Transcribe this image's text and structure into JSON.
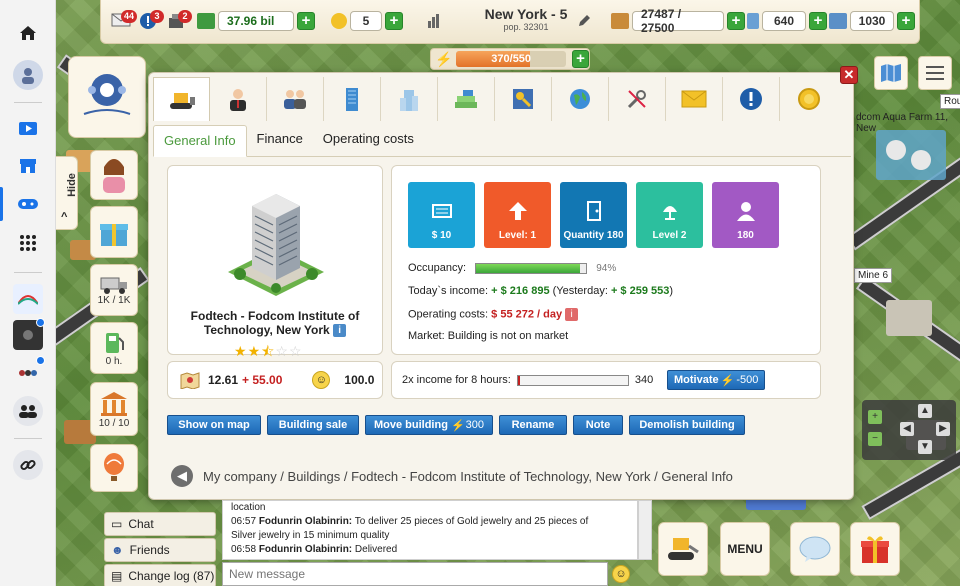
{
  "sidebar": {
    "items": [
      {
        "name": "home-icon",
        "glyph": "⌂"
      },
      {
        "name": "profile-icon",
        "glyph": "●"
      },
      {
        "name": "video-icon",
        "glyph": "▶"
      },
      {
        "name": "store-icon",
        "glyph": "▦"
      },
      {
        "name": "gaming-icon",
        "glyph": "◉"
      },
      {
        "name": "apps-grid-icon",
        "glyph": "⠿"
      },
      {
        "name": "page-icon-1",
        "glyph": "◆"
      },
      {
        "name": "page-icon-2",
        "glyph": "◆"
      },
      {
        "name": "page-icon-3",
        "glyph": "◆"
      },
      {
        "name": "groups-icon",
        "glyph": "☻"
      },
      {
        "name": "link-icon",
        "glyph": "⛓"
      }
    ]
  },
  "topbar": {
    "mail_count": "44",
    "alerts_count": "3",
    "notices_count": "2",
    "money": "37.96 bil",
    "coins": "5",
    "city_name": "New York - 5",
    "city_pop": "pop. 32301",
    "workers": "27487 / 27500",
    "buildings": "640",
    "transport": "1030",
    "energy": "370/550",
    "energy_fraction": 0.673
  },
  "left_column": {
    "hide_label": "Hide",
    "trucks_label": "1K / 1K",
    "fuel_label": "0 h.",
    "bank_label": "10 / 10"
  },
  "dialog": {
    "sub_tabs": [
      "General Info",
      "Finance",
      "Operating costs"
    ],
    "building": {
      "name": "Fodtech - Fodcom Institute of Technology, New York",
      "info_glyph": "i",
      "stars_full": 2,
      "stars_half": 1,
      "stars_empty": 2
    },
    "tiles": [
      {
        "label": "$ 10",
        "color": "#1ba3d6",
        "icon": "money-icon"
      },
      {
        "label": "Level: 1",
        "color": "#f05a2a",
        "icon": "level-up-icon"
      },
      {
        "label": "Quantity 180",
        "color": "#1277b3",
        "icon": "door-icon"
      },
      {
        "label": "Level 2",
        "color": "#2cbf9e",
        "icon": "lamp-icon"
      },
      {
        "label": "180",
        "color": "#a259c4",
        "icon": "person-icon"
      }
    ],
    "occupancy_label": "Occupancy:",
    "occupancy_percent": "94%",
    "occupancy_value": 0.94,
    "income_label": "Today`s income:",
    "income_value": "+ $ 216 895",
    "yesterday_label": "(Yesterday:",
    "yesterday_value": "+ $ 259 553",
    "yesterday_close": ")",
    "costs_label": "Operating costs:",
    "costs_value": "$ 55 272 / day",
    "market_label": "Market: Building is not on market",
    "rating_value": "12.61",
    "rating_delta": "+ 55.00",
    "happiness_value": "100.0",
    "boost_label": "2x income for 8 hours:",
    "boost_value": "340",
    "motivate_label": "Motivate",
    "motivate_cost": "-500",
    "actions": [
      {
        "label": "Show on map",
        "name": "show-on-map-button",
        "suffix": ""
      },
      {
        "label": "Building sale",
        "name": "building-sale-button",
        "suffix": ""
      },
      {
        "label": "Move building",
        "name": "move-building-button",
        "suffix": "300"
      },
      {
        "label": "Rename",
        "name": "rename-button",
        "suffix": ""
      },
      {
        "label": "Note",
        "name": "note-button",
        "suffix": ""
      },
      {
        "label": "Demolish building",
        "name": "demolish-building-button",
        "suffix": ""
      }
    ],
    "breadcrumb": "My company / Buildings / Fodtech - Fodcom Institute of Technology, New York / General Info"
  },
  "chat": {
    "tabs": [
      "Chat",
      "Friends",
      "Change log (87)"
    ],
    "lines": [
      {
        "time": "",
        "author": "",
        "text": "location"
      },
      {
        "time": "06:57",
        "author": "Fodunrin Olabinrin:",
        "text": "To deliver 25 pieces of Gold jewelry and 25 pieces of"
      },
      {
        "time": "",
        "author": "",
        "text": "Silver jewelry in 15 minimum quality"
      },
      {
        "time": "06:58",
        "author": "Fodunrin Olabinrin:",
        "text": "Delivered"
      }
    ],
    "input_placeholder": "New message"
  },
  "bottom": {
    "menu_label": "MENU"
  },
  "map_labels": {
    "farm": "dcom Aqua Farm 11, New",
    "rou": "Rou",
    "mine": "Mine 6"
  },
  "colors": {
    "accent_green": "#4b9a3d",
    "button_blue": "#1d69b6",
    "danger_red": "#c42020"
  }
}
